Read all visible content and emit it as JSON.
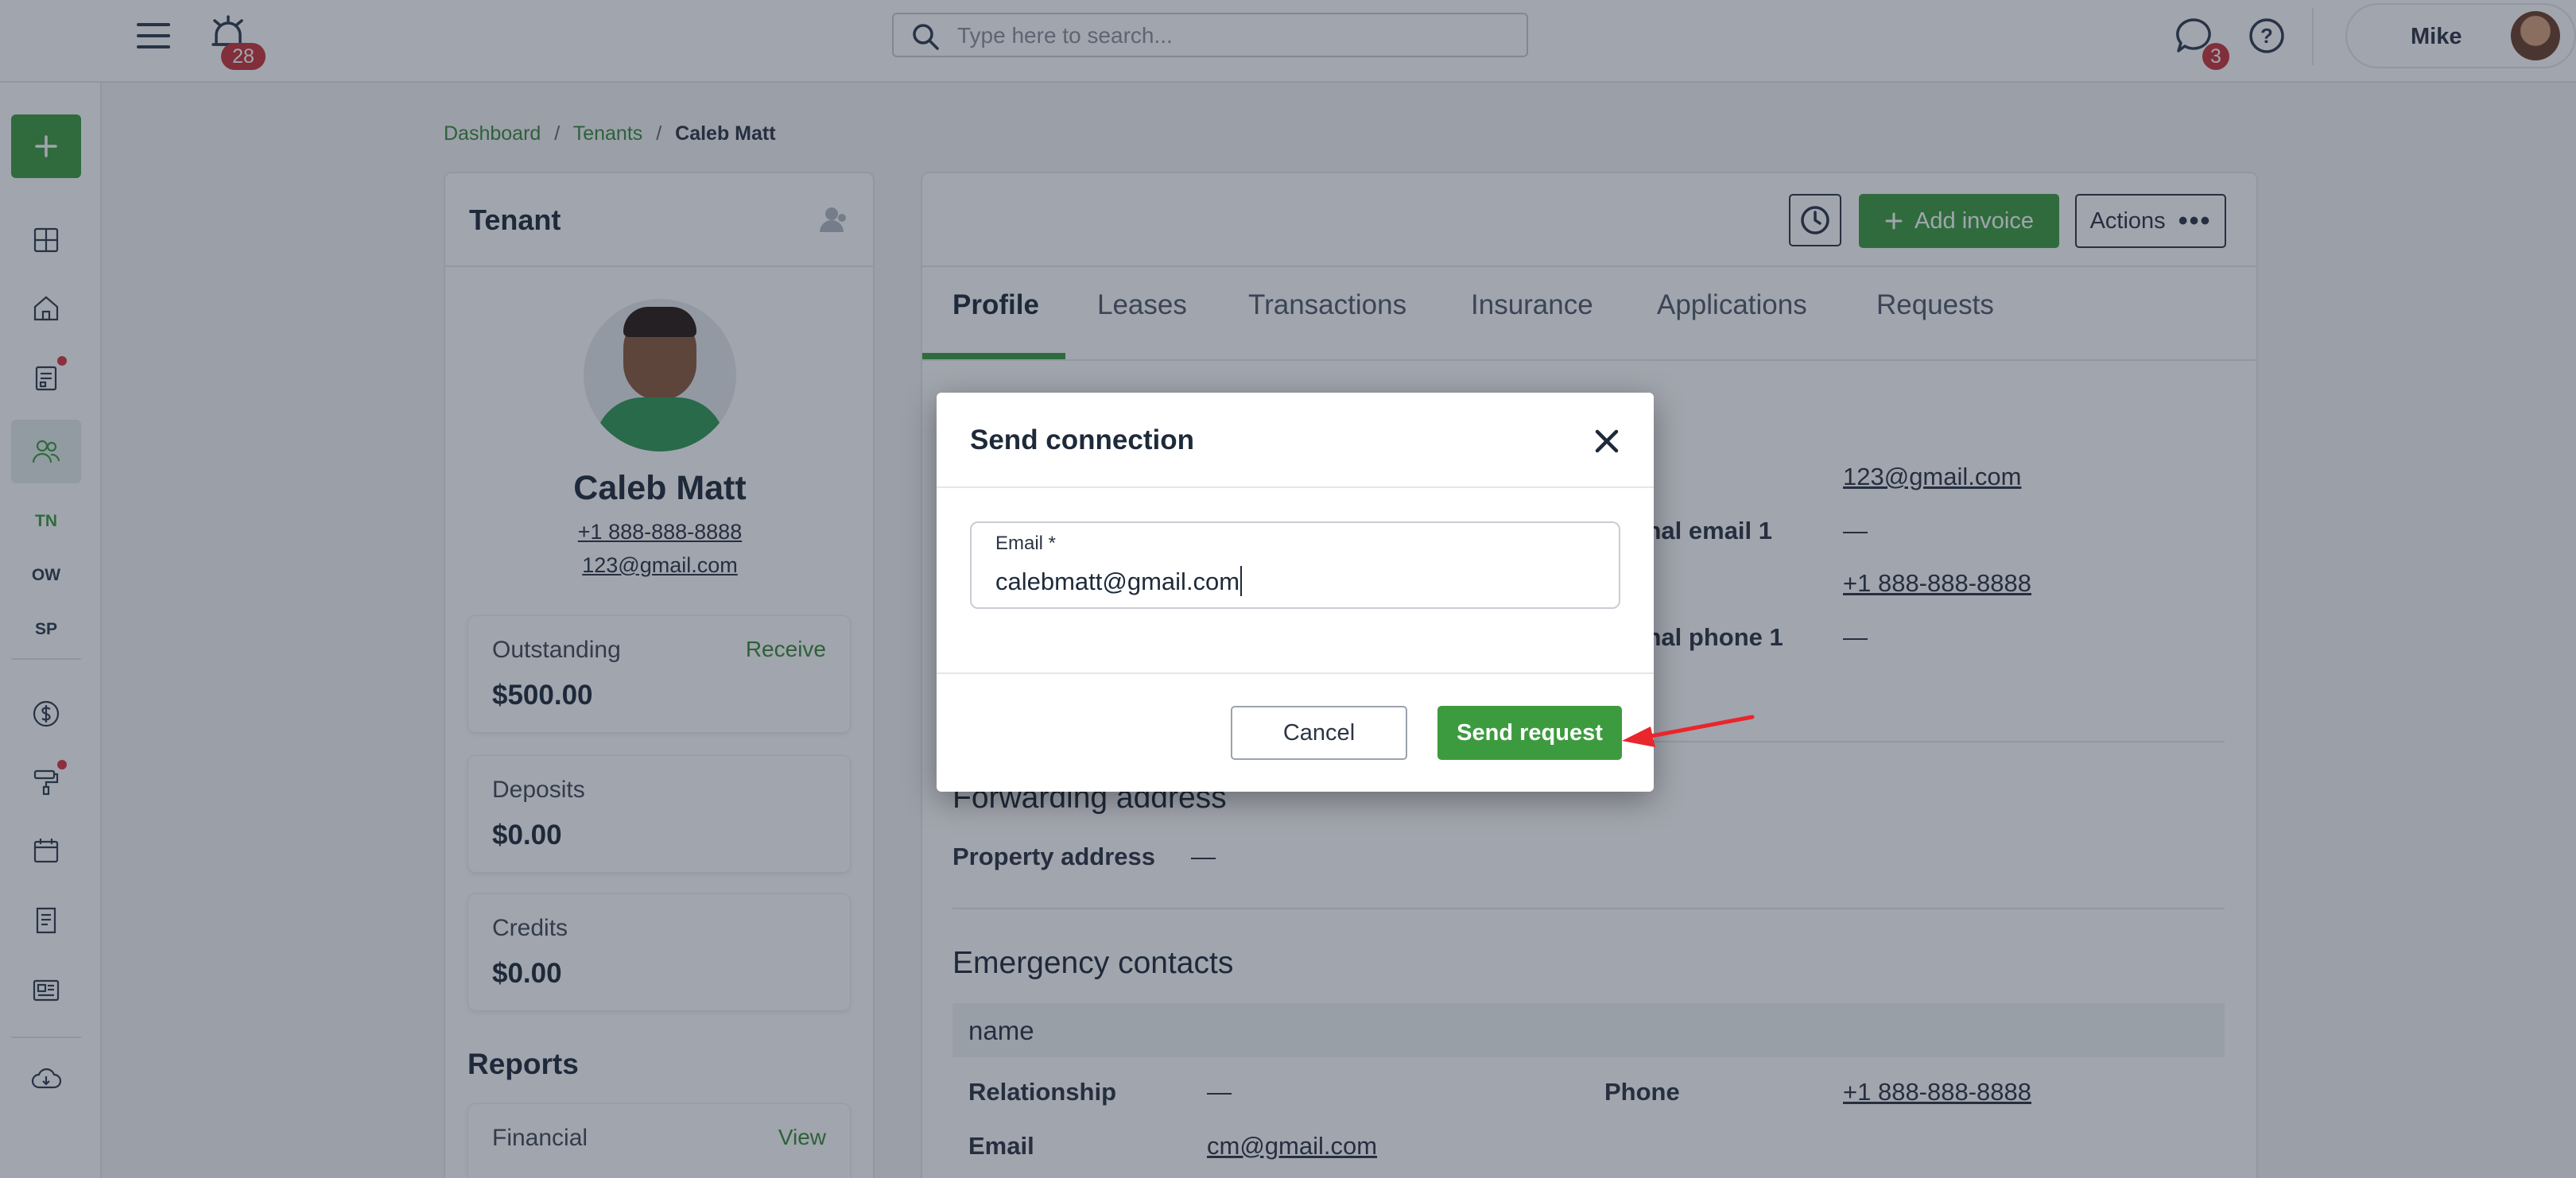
{
  "topbar": {
    "search_placeholder": "Type here to search...",
    "alarm_count": "28",
    "message_count": "3",
    "user_name": "Mike"
  },
  "sidebar": {
    "items": [
      "TN",
      "OW",
      "SP"
    ]
  },
  "breadcrumb": {
    "items": [
      "Dashboard",
      "Tenants",
      "Caleb Matt"
    ],
    "separator": "/"
  },
  "tenant_card": {
    "heading": "Tenant",
    "name": "Caleb Matt",
    "phone": "+1 888-888-8888",
    "email": "123@gmail.com",
    "outstanding_label": "Outstanding",
    "outstanding_value": "$500.00",
    "receive_label": "Receive",
    "deposits_label": "Deposits",
    "deposits_value": "$0.00",
    "credits_label": "Credits",
    "credits_value": "$0.00",
    "reports_heading": "Reports",
    "financial_label": "Financial",
    "view_label": "View"
  },
  "actions": {
    "add_invoice": "Add invoice",
    "actions_label": "Actions"
  },
  "tabs": [
    "Profile",
    "Leases",
    "Transactions",
    "Insurance",
    "Applications",
    "Requests"
  ],
  "profile": {
    "email_label_partial": "il",
    "email_value": "123@gmail.com",
    "add_email_label_partial": "itional email 1",
    "add_email_value": "—",
    "phone_label_partial": "ne",
    "phone_value": "+1 888-888-8888",
    "add_phone_label_partial": "itional phone 1",
    "add_phone_value": "—",
    "forwarding_heading": "Forwarding address",
    "property_address_label": "Property address",
    "property_address_value": "—",
    "emergency_heading": "Emergency contacts",
    "contact_name": "name",
    "relationship_label": "Relationship",
    "relationship_value": "—",
    "contact_phone_label": "Phone",
    "contact_phone_value": "+1 888-888-8888",
    "contact_email_label": "Email",
    "contact_email_value": "cm@gmail.com"
  },
  "modal": {
    "title": "Send connection",
    "email_label": "Email *",
    "email_value": "calebmatt@gmail.com",
    "cancel_label": "Cancel",
    "send_label": "Send request"
  },
  "colors": {
    "brand_green": "#3d9b3f",
    "badge_red": "#c6343b",
    "annotation_arrow": "#e8262c"
  }
}
